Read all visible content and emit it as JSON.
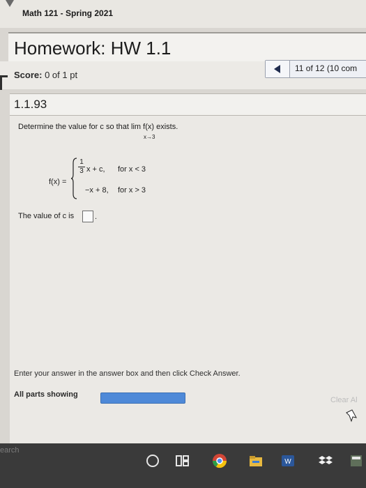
{
  "header": {
    "course": "Math 121 - Spring 2021",
    "homework_title": "Homework: HW 1.1"
  },
  "score": {
    "label": "Score:",
    "value": "0 of 1 pt"
  },
  "navigation": {
    "position": "11 of 12 (10 com"
  },
  "problem": {
    "number": "1.1.93",
    "prompt": "Determine the value for c so that  lim f(x) exists.",
    "limit_subscript": "x→3",
    "function_label": "f(x) =",
    "piece1_numerator": "1",
    "piece1_denominator": "3",
    "piece1_expression": "x + c,",
    "piece1_condition": "for x < 3",
    "piece2_expression": "−x + 8,",
    "piece2_condition": "for x > 3",
    "answer_prefix": "The value of c is",
    "answer_suffix": "."
  },
  "footer": {
    "instructions": "Enter your answer in the answer box and then click Check Answer.",
    "parts_label": "All parts showing",
    "progress": 1.0,
    "clear_all": "Clear Al"
  },
  "taskbar": {
    "search": "earch"
  },
  "colors": {
    "progress_fill": "#4e89d8",
    "background": "#d9d6d1"
  }
}
